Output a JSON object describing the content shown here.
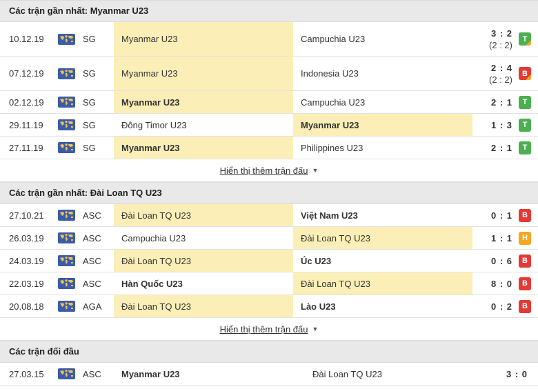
{
  "sections": [
    {
      "title": "Các trận gần nhất: Myanmar U23",
      "more_label": "Hiển thị thêm trận đấu",
      "matches": [
        {
          "date": "10.12.19",
          "comp": "SG",
          "home": "Myanmar U23",
          "away": "Campuchia U23",
          "score": "3 : 2",
          "sub": "(2 : 2)",
          "result": "T",
          "result_type": "win",
          "hl": "home",
          "bold": "",
          "corner": true
        },
        {
          "date": "07.12.19",
          "comp": "SG",
          "home": "Myanmar U23",
          "away": "Indonesia U23",
          "score": "2 : 4",
          "sub": "(2 : 2)",
          "result": "B",
          "result_type": "loss",
          "hl": "home",
          "bold": "",
          "corner": true
        },
        {
          "date": "02.12.19",
          "comp": "SG",
          "home": "Myanmar U23",
          "away": "Campuchia U23",
          "score": "2 : 1",
          "sub": "",
          "result": "T",
          "result_type": "win",
          "hl": "home",
          "bold": "home",
          "corner": false
        },
        {
          "date": "29.11.19",
          "comp": "SG",
          "home": "Đông Timor U23",
          "away": "Myanmar U23",
          "score": "1 : 3",
          "sub": "",
          "result": "T",
          "result_type": "win",
          "hl": "away",
          "bold": "away",
          "corner": false
        },
        {
          "date": "27.11.19",
          "comp": "SG",
          "home": "Myanmar U23",
          "away": "Philippines U23",
          "score": "2 : 1",
          "sub": "",
          "result": "T",
          "result_type": "win",
          "hl": "home",
          "bold": "home",
          "corner": false
        }
      ]
    },
    {
      "title": "Các trận gần nhất: Đài Loan TQ U23",
      "more_label": "Hiển thị thêm trận đấu",
      "matches": [
        {
          "date": "27.10.21",
          "comp": "ASC",
          "home": "Đài Loan TQ U23",
          "away": "Việt Nam U23",
          "score": "0 : 1",
          "sub": "",
          "result": "B",
          "result_type": "loss",
          "hl": "home",
          "bold": "away",
          "corner": false
        },
        {
          "date": "26.03.19",
          "comp": "ASC",
          "home": "Campuchia U23",
          "away": "Đài Loan TQ U23",
          "score": "1 : 1",
          "sub": "",
          "result": "H",
          "result_type": "draw",
          "hl": "away",
          "bold": "",
          "corner": false
        },
        {
          "date": "24.03.19",
          "comp": "ASC",
          "home": "Đài Loan TQ U23",
          "away": "Úc U23",
          "score": "0 : 6",
          "sub": "",
          "result": "B",
          "result_type": "loss",
          "hl": "home",
          "bold": "away",
          "corner": false
        },
        {
          "date": "22.03.19",
          "comp": "ASC",
          "home": "Hàn Quốc U23",
          "away": "Đài Loan TQ U23",
          "score": "8 : 0",
          "sub": "",
          "result": "B",
          "result_type": "loss",
          "hl": "away",
          "bold": "home",
          "corner": false
        },
        {
          "date": "20.08.18",
          "comp": "AGA",
          "home": "Đài Loan TQ U23",
          "away": "Lào U23",
          "score": "0 : 2",
          "sub": "",
          "result": "B",
          "result_type": "loss",
          "hl": "home",
          "bold": "away",
          "corner": false
        }
      ]
    }
  ],
  "h2h": {
    "title": "Các trận đối đầu",
    "matches": [
      {
        "date": "27.03.15",
        "comp": "ASC",
        "home": "Myanmar U23",
        "away": "Đài Loan TQ U23",
        "score": "3 : 0"
      }
    ]
  },
  "icons": {
    "flag": "world-map-flag-icon",
    "caret": "caret-down-icon"
  },
  "colors": {
    "highlight": "#fbefb7",
    "win": "#4caf50",
    "loss": "#e53935",
    "draw": "#f5a623",
    "flag": "#3a5ca9"
  }
}
